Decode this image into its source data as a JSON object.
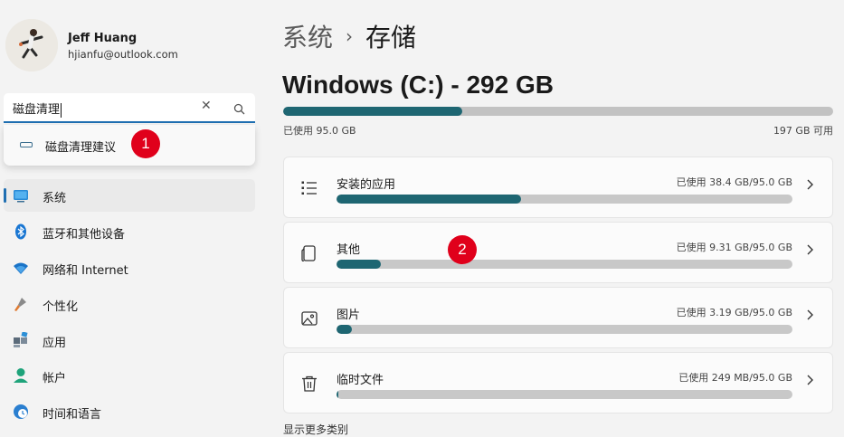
{
  "user": {
    "name": "Jeff Huang",
    "email": "hjianfu@outlook.com"
  },
  "search": {
    "value": "磁盘清理",
    "suggestion": "磁盘清理建议",
    "badge": "1"
  },
  "nav": [
    {
      "label": "系统",
      "icon": "system-icon",
      "active": true
    },
    {
      "label": "蓝牙和其他设备",
      "icon": "bluetooth-icon"
    },
    {
      "label": "网络和 Internet",
      "icon": "wifi-icon"
    },
    {
      "label": "个性化",
      "icon": "brush-icon"
    },
    {
      "label": "应用",
      "icon": "apps-icon"
    },
    {
      "label": "帐户",
      "icon": "account-icon"
    },
    {
      "label": "时间和语言",
      "icon": "globe-icon"
    }
  ],
  "breadcrumb": {
    "parent": "系统",
    "separator": "›",
    "current": "存储"
  },
  "drive": {
    "title": "Windows (C:) - 292 GB",
    "used_label": "已使用 95.0 GB",
    "free_label": "197 GB 可用",
    "used_fraction": 0.325
  },
  "categories": [
    {
      "label": "安装的应用",
      "usage": "已使用 38.4 GB/95.0 GB",
      "fraction": 0.404,
      "icon": "list-icon"
    },
    {
      "label": "其他",
      "usage": "已使用 9.31 GB/95.0 GB",
      "fraction": 0.098,
      "icon": "other-icon"
    },
    {
      "label": "图片",
      "usage": "已使用 3.19 GB/95.0 GB",
      "fraction": 0.034,
      "icon": "picture-icon"
    },
    {
      "label": "临时文件",
      "usage": "已使用 249 MB/95.0 GB",
      "fraction": 0.003,
      "icon": "trash-icon"
    }
  ],
  "badge2": "2",
  "more_link": "显示更多类别",
  "colors": {
    "accent": "#1f6fb2",
    "bar_fill": "#1e6672",
    "bar_track": "#c2c2c2",
    "badge": "#e0001b"
  }
}
